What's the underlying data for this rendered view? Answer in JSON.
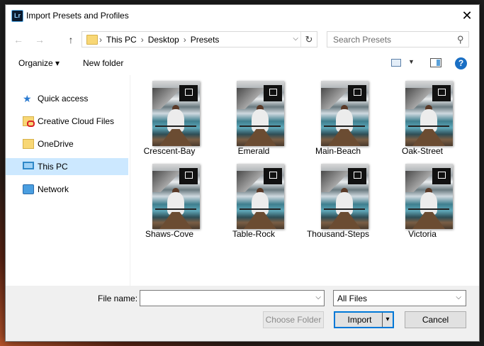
{
  "window": {
    "title": "Import Presets and Profiles",
    "app_icon_text": "Lr",
    "close_glyph": "✕"
  },
  "nav": {
    "back_glyph": "←",
    "forward_glyph": "→",
    "up_glyph": "↑",
    "refresh_glyph": "↻",
    "dropdown_glyph": "⌵"
  },
  "breadcrumb": [
    "This PC",
    "Desktop",
    "Presets"
  ],
  "breadcrumb_sep": "›",
  "search": {
    "placeholder": "Search Presets",
    "icon": "search-icon"
  },
  "toolbar": {
    "organize_label": "Organize ▾",
    "new_folder_label": "New folder",
    "view_dd_glyph": "▼",
    "help_glyph": "?"
  },
  "sidebar": {
    "items": [
      {
        "label": "Quick access",
        "icon": "star-icon",
        "selected": false
      },
      {
        "label": "Creative Cloud Files",
        "icon": "creative-cloud-folder-icon",
        "selected": false
      },
      {
        "label": "OneDrive",
        "icon": "folder-icon",
        "selected": false
      },
      {
        "label": "This PC",
        "icon": "computer-icon",
        "selected": true
      },
      {
        "label": "Network",
        "icon": "network-icon",
        "selected": false
      }
    ]
  },
  "files": [
    {
      "name": "Crescent-Bay"
    },
    {
      "name": "Emerald"
    },
    {
      "name": "Main-Beach"
    },
    {
      "name": "Oak-Street"
    },
    {
      "name": "Shaws-Cove"
    },
    {
      "name": "Table-Rock"
    },
    {
      "name": "Thousand-Steps"
    },
    {
      "name": "Victoria"
    }
  ],
  "footer": {
    "file_name_label": "File name:",
    "file_name_value": "",
    "file_type": "All Files",
    "choose_folder_label": "Choose Folder",
    "import_label": "Import",
    "cancel_label": "Cancel",
    "dropdown_glyph": "⌵"
  },
  "colors": {
    "accent": "#0078d7",
    "selection": "#cce8ff",
    "footer_bg": "#f0f0f0"
  }
}
